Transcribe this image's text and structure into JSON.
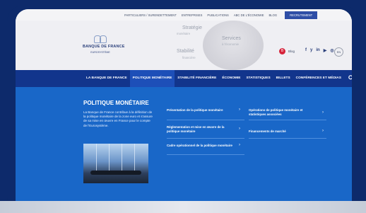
{
  "topbar": {
    "links": [
      "PARTICULIERS / SURENDETTEMENT",
      "ENTREPRISES",
      "PUBLICATIONS",
      "ABC DE L'ÉCONOMIE",
      "BLOG"
    ],
    "recruit": "RECRUTEMENT"
  },
  "header": {
    "logo_name": "BANQUE DE FRANCE",
    "logo_sub": "EUROSYSTÈME",
    "words": [
      {
        "title": "Stratégie",
        "sub": "monétaire"
      },
      {
        "title": "Stabilité",
        "sub": "financière"
      },
      {
        "title": "Services",
        "sub": "à l'économie"
      }
    ],
    "blog_label": "Blog",
    "social": [
      "f",
      "y",
      "in",
      "yt",
      "ig"
    ],
    "lang": "EN"
  },
  "nav": {
    "items": [
      "LA BANQUE DE FRANCE",
      "POLITIQUE MONÉTAIRE",
      "STABILITÉ FINANCIÈRE",
      "ÉCONOMIE",
      "STATISTIQUES",
      "BILLETS",
      "CONFÉRENCES ET MÉDIAS"
    ],
    "search_icon": "search-icon"
  },
  "panel": {
    "title": "POLITIQUE MONÉTAIRE",
    "description": "La Banque de France contribue à la définition de la politique monétaire de la zone euro et s'assure de sa mise en œuvre en France pour le compte de l'Eurosystème.",
    "col1": [
      "Présentation de la politique monétaire",
      "Réglementation et mise en œuvre de la politique monétaire",
      "Cadre opérationnel de la politique monétaire"
    ],
    "col2": [
      "Opérations de politique monétaire et statistiques associées",
      "Financements de marché"
    ],
    "chevron": "›"
  },
  "colors": {
    "nav": "#12358c",
    "panel": "#1967c8",
    "frame": "#0d2a6b"
  }
}
